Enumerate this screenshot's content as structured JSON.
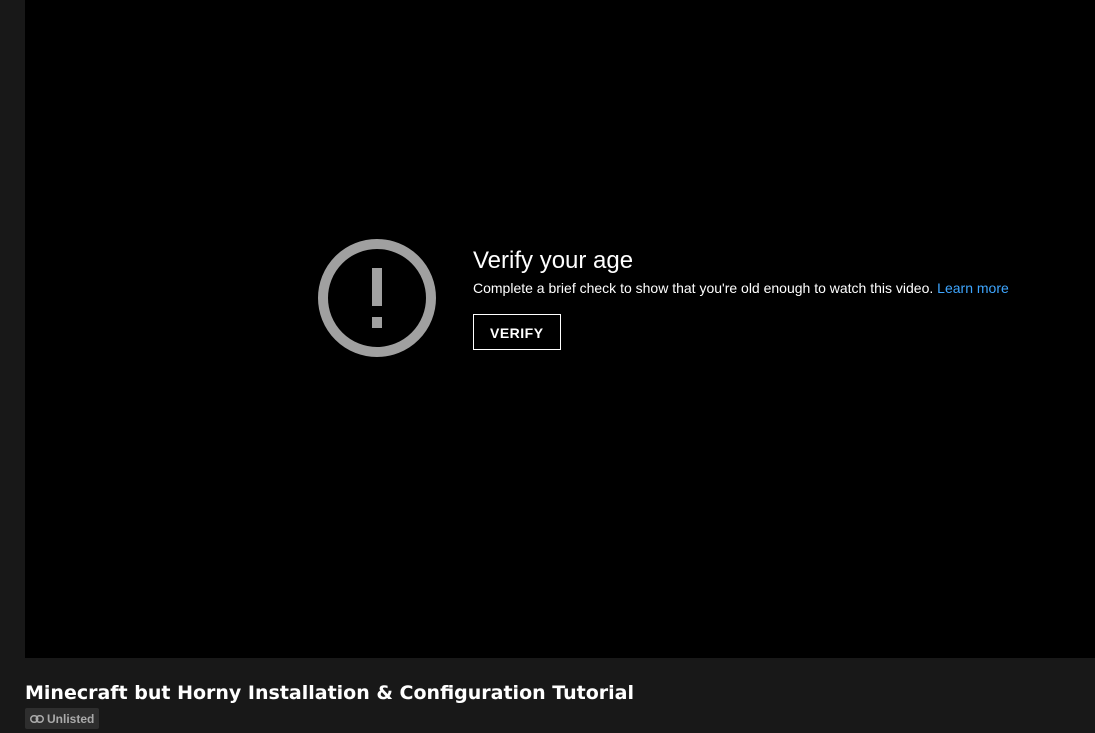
{
  "age_gate": {
    "icon": "alert-circle-icon",
    "title": "Verify your age",
    "description": "Complete a brief check to show that you're old enough to watch this video.",
    "learn_more": "Learn more",
    "verify_button": "VERIFY"
  },
  "video": {
    "title": "Minecraft but Horny Installation & Configuration Tutorial",
    "visibility_badge": "Unlisted",
    "visibility_icon": "link-icon"
  },
  "colors": {
    "player_bg": "#000000",
    "page_bg": "#181818",
    "link": "#3ea6ff",
    "icon_gray": "#a0a0a0"
  }
}
